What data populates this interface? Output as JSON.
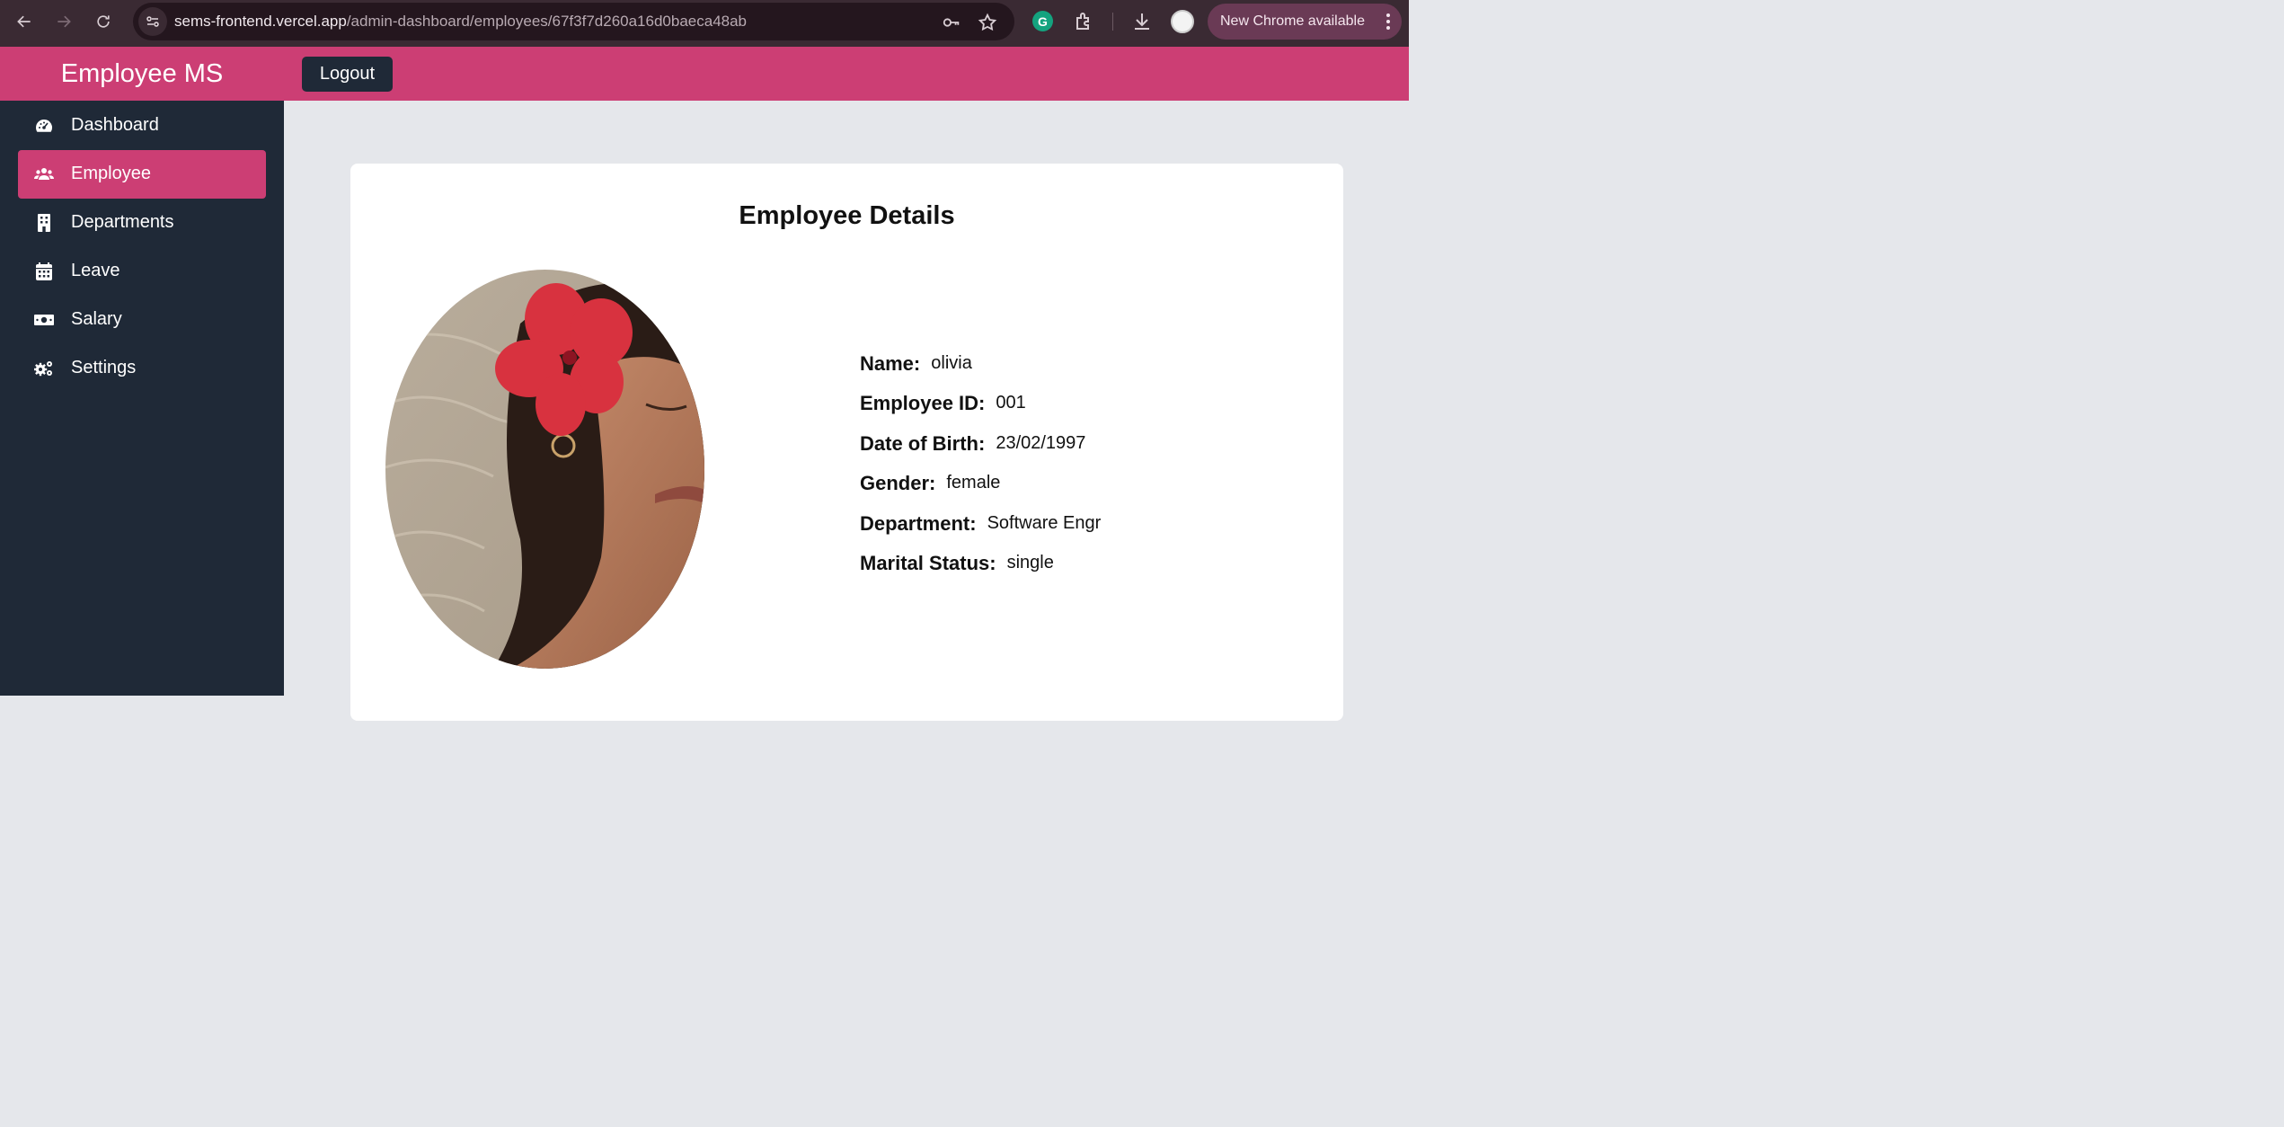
{
  "browser": {
    "url_host": "sems-frontend.vercel.app",
    "url_path": "/admin-dashboard/employees/67f3f7d260a16d0baeca48ab",
    "update_label": "New Chrome available"
  },
  "header": {
    "brand": "Employee MS",
    "logout_label": "Logout",
    "color": "#cc3e74"
  },
  "sidebar": {
    "items": [
      {
        "label": "Dashboard",
        "icon": "tachometer-icon",
        "active": false
      },
      {
        "label": "Employee",
        "icon": "users-icon",
        "active": true
      },
      {
        "label": "Departments",
        "icon": "building-icon",
        "active": false
      },
      {
        "label": "Leave",
        "icon": "calendar-icon",
        "active": false
      },
      {
        "label": "Salary",
        "icon": "money-bill-icon",
        "active": false
      },
      {
        "label": "Settings",
        "icon": "cogs-icon",
        "active": false
      }
    ]
  },
  "main": {
    "title": "Employee Details",
    "fields": [
      {
        "label": "Name:",
        "value": "olivia"
      },
      {
        "label": "Employee ID:",
        "value": "001"
      },
      {
        "label": "Date of Birth:",
        "value": "23/02/1997"
      },
      {
        "label": "Gender:",
        "value": "female"
      },
      {
        "label": "Department:",
        "value": "Software Engr"
      },
      {
        "label": "Marital Status:",
        "value": "single"
      }
    ]
  }
}
